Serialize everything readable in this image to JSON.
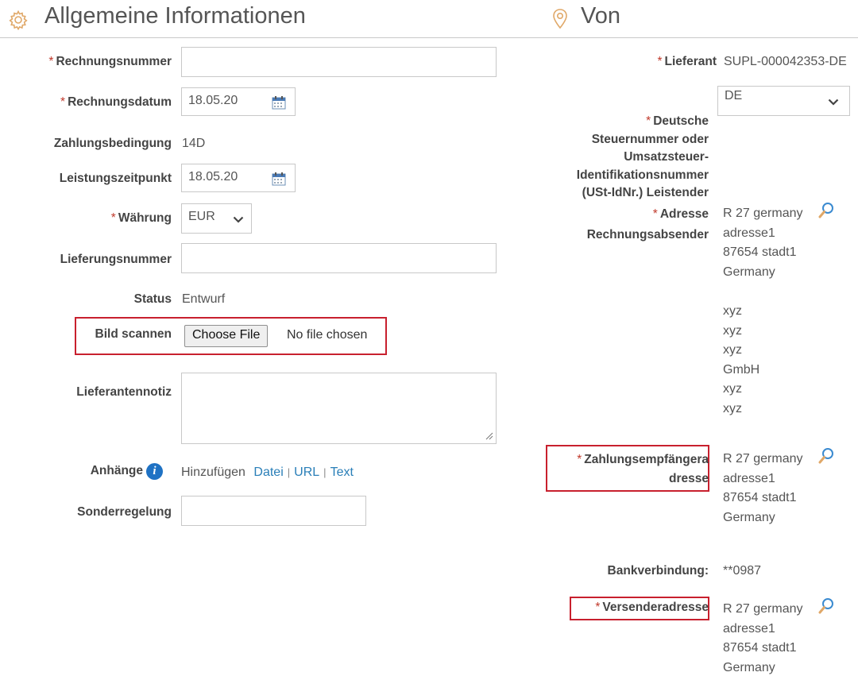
{
  "general": {
    "title": "Allgemeine Informationen",
    "fields": {
      "invoice_number": {
        "label": "Rechnungsnummer",
        "value": ""
      },
      "invoice_date": {
        "label": "Rechnungsdatum",
        "value": "18.05.20"
      },
      "payment_terms": {
        "label": "Zahlungsbedingung",
        "value": "14D"
      },
      "service_date": {
        "label": "Leistungszeitpunkt",
        "value": "18.05.20"
      },
      "currency": {
        "label": "Währung",
        "value": "EUR"
      },
      "delivery_number": {
        "label": "Lieferungsnummer",
        "value": ""
      },
      "status": {
        "label": "Status",
        "value": "Entwurf"
      },
      "scan_image": {
        "label": "Bild scannen",
        "button": "Choose File",
        "file_text": "No file chosen"
      },
      "supplier_note": {
        "label": "Lieferantennotiz",
        "value": ""
      },
      "attachments": {
        "label": "Anhänge",
        "add_text": "Hinzufügen",
        "links": [
          "Datei",
          "URL",
          "Text"
        ],
        "separator": "|"
      },
      "special_rule": {
        "label": "Sonderregelung",
        "value": ""
      }
    }
  },
  "from": {
    "title": "Von",
    "supplier": {
      "label": "Lieferant",
      "value": "SUPL-000042353-DE"
    },
    "tax_number": {
      "label_lines": [
        "Deutsche",
        "Steuernummer oder",
        "Umsatzsteuer-",
        "Identifikationsnummer",
        "(USt-IdNr.) Leistender"
      ],
      "value": "DE"
    },
    "sender_address": {
      "label_lines": [
        "Adresse",
        "Rechnungsabsender"
      ],
      "lines": [
        "R 27 germany",
        "adresse1",
        "87654 stadt1",
        "Germany"
      ],
      "extra_lines": [
        "xyz",
        "xyz",
        "xyz",
        "GmbH",
        "xyz",
        "xyz"
      ]
    },
    "payee_address": {
      "label_lines": [
        "Zahlungsempfängera",
        "dresse"
      ],
      "lines": [
        "R 27 germany",
        "adresse1",
        "87654 stadt1",
        "Germany"
      ]
    },
    "bank": {
      "label": "Bankverbindung:",
      "value": "**0987"
    },
    "shipper_address": {
      "label": "Versenderadresse",
      "lines": [
        "R 27 germany",
        "adresse1",
        "87654 stadt1",
        "Germany"
      ]
    }
  },
  "required_marker": "*",
  "colors": {
    "required": "#c0392b",
    "link": "#2a7fb8",
    "highlight": "#c8202e",
    "info": "#1f72c4"
  }
}
